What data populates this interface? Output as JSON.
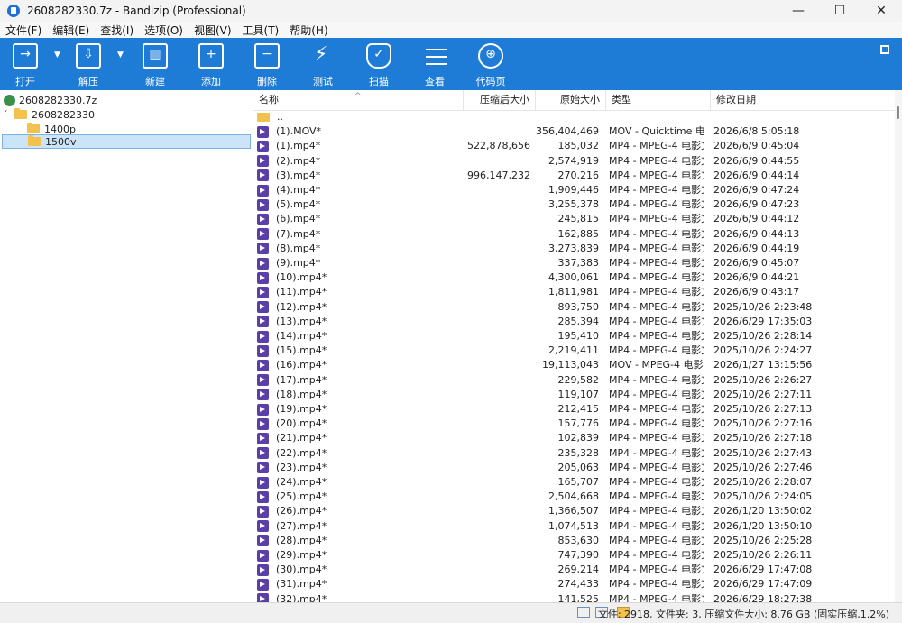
{
  "window": {
    "title": "2608282330.7z - Bandizip (Professional)",
    "minimize": "—",
    "maximize": "☐",
    "close": "✕"
  },
  "menu": [
    "文件(F)",
    "编辑(E)",
    "查找(I)",
    "选项(O)",
    "视图(V)",
    "工具(T)",
    "帮助(H)"
  ],
  "toolbar": {
    "color": "#1e7bd6",
    "buttons": [
      {
        "label": "打开",
        "icon": "open-icon"
      },
      {
        "label": "解压",
        "icon": "extract-icon"
      },
      {
        "label": "新建",
        "icon": "new-archive-icon"
      },
      {
        "label": "添加",
        "icon": "add-icon"
      },
      {
        "label": "删除",
        "icon": "delete-icon"
      },
      {
        "label": "测试",
        "icon": "test-icon"
      },
      {
        "label": "扫描",
        "icon": "scan-shield-icon"
      },
      {
        "label": "查看",
        "icon": "view-list-icon"
      },
      {
        "label": "代码页",
        "icon": "codepage-globe-icon"
      }
    ]
  },
  "tree": {
    "archive": "2608282330.7z",
    "root_folder": "2608282330",
    "children": [
      "1400p",
      "1500v"
    ],
    "selected": "1500v"
  },
  "list": {
    "headers": {
      "name": "名称",
      "compressed": "压缩后大小",
      "original": "原始大小",
      "type": "类型",
      "modified": "修改日期"
    },
    "rows": [
      {
        "name": "..",
        "compressed": "",
        "original": "",
        "type": "",
        "modified": ""
      },
      {
        "name": "(1).MOV*",
        "compressed": "",
        "original": "356,404,469",
        "type": "MOV - Quicktime 电...",
        "modified": "2026/6/8 5:05:18"
      },
      {
        "name": "(1).mp4*",
        "compressed": "522,878,656",
        "original": "185,032",
        "type": "MP4 - MPEG-4 电影文...",
        "modified": "2026/6/9 0:45:04"
      },
      {
        "name": "(2).mp4*",
        "compressed": "",
        "original": "2,574,919",
        "type": "MP4 - MPEG-4 电影文...",
        "modified": "2026/6/9 0:44:55"
      },
      {
        "name": "(3).mp4*",
        "compressed": "996,147,232",
        "original": "270,216",
        "type": "MP4 - MPEG-4 电影文...",
        "modified": "2026/6/9 0:44:14"
      },
      {
        "name": "(4).mp4*",
        "compressed": "",
        "original": "1,909,446",
        "type": "MP4 - MPEG-4 电影文...",
        "modified": "2026/6/9 0:47:24"
      },
      {
        "name": "(5).mp4*",
        "compressed": "",
        "original": "3,255,378",
        "type": "MP4 - MPEG-4 电影文...",
        "modified": "2026/6/9 0:47:23"
      },
      {
        "name": "(6).mp4*",
        "compressed": "",
        "original": "245,815",
        "type": "MP4 - MPEG-4 电影文...",
        "modified": "2026/6/9 0:44:12"
      },
      {
        "name": "(7).mp4*",
        "compressed": "",
        "original": "162,885",
        "type": "MP4 - MPEG-4 电影文...",
        "modified": "2026/6/9 0:44:13"
      },
      {
        "name": "(8).mp4*",
        "compressed": "",
        "original": "3,273,839",
        "type": "MP4 - MPEG-4 电影文...",
        "modified": "2026/6/9 0:44:19"
      },
      {
        "name": "(9).mp4*",
        "compressed": "",
        "original": "337,383",
        "type": "MP4 - MPEG-4 电影文...",
        "modified": "2026/6/9 0:45:07"
      },
      {
        "name": "(10).mp4*",
        "compressed": "",
        "original": "4,300,061",
        "type": "MP4 - MPEG-4 电影文...",
        "modified": "2026/6/9 0:44:21"
      },
      {
        "name": "(11).mp4*",
        "compressed": "",
        "original": "1,811,981",
        "type": "MP4 - MPEG-4 电影文...",
        "modified": "2026/6/9 0:43:17"
      },
      {
        "name": "(12).mp4*",
        "compressed": "",
        "original": "893,750",
        "type": "MP4 - MPEG-4 电影文...",
        "modified": "2025/10/26 2:23:48"
      },
      {
        "name": "(13).mp4*",
        "compressed": "",
        "original": "285,394",
        "type": "MP4 - MPEG-4 电影文...",
        "modified": "2026/6/29 17:35:03"
      },
      {
        "name": "(14).mp4*",
        "compressed": "",
        "original": "195,410",
        "type": "MP4 - MPEG-4 电影文...",
        "modified": "2025/10/26 2:28:14"
      },
      {
        "name": "(15).mp4*",
        "compressed": "",
        "original": "2,219,411",
        "type": "MP4 - MPEG-4 电影文...",
        "modified": "2025/10/26 2:24:27"
      },
      {
        "name": "(16).mp4*",
        "compressed": "",
        "original": "19,113,043",
        "type": "MOV - MPEG-4 电影文...",
        "modified": "2026/1/27 13:15:56"
      },
      {
        "name": "(17).mp4*",
        "compressed": "",
        "original": "229,582",
        "type": "MP4 - MPEG-4 电影文...",
        "modified": "2025/10/26 2:26:27"
      },
      {
        "name": "(18).mp4*",
        "compressed": "",
        "original": "119,107",
        "type": "MP4 - MPEG-4 电影文...",
        "modified": "2025/10/26 2:27:11"
      },
      {
        "name": "(19).mp4*",
        "compressed": "",
        "original": "212,415",
        "type": "MP4 - MPEG-4 电影文...",
        "modified": "2025/10/26 2:27:13"
      },
      {
        "name": "(20).mp4*",
        "compressed": "",
        "original": "157,776",
        "type": "MP4 - MPEG-4 电影文...",
        "modified": "2025/10/26 2:27:16"
      },
      {
        "name": "(21).mp4*",
        "compressed": "",
        "original": "102,839",
        "type": "MP4 - MPEG-4 电影文...",
        "modified": "2025/10/26 2:27:18"
      },
      {
        "name": "(22).mp4*",
        "compressed": "",
        "original": "235,328",
        "type": "MP4 - MPEG-4 电影文...",
        "modified": "2025/10/26 2:27:43"
      },
      {
        "name": "(23).mp4*",
        "compressed": "",
        "original": "205,063",
        "type": "MP4 - MPEG-4 电影文...",
        "modified": "2025/10/26 2:27:46"
      },
      {
        "name": "(24).mp4*",
        "compressed": "",
        "original": "165,707",
        "type": "MP4 - MPEG-4 电影文...",
        "modified": "2025/10/26 2:28:07"
      },
      {
        "name": "(25).mp4*",
        "compressed": "",
        "original": "2,504,668",
        "type": "MP4 - MPEG-4 电影文...",
        "modified": "2025/10/26 2:24:05"
      },
      {
        "name": "(26).mp4*",
        "compressed": "",
        "original": "1,366,507",
        "type": "MP4 - MPEG-4 电影文...",
        "modified": "2026/1/20 13:50:02"
      },
      {
        "name": "(27).mp4*",
        "compressed": "",
        "original": "1,074,513",
        "type": "MP4 - MPEG-4 电影文...",
        "modified": "2026/1/20 13:50:10"
      },
      {
        "name": "(28).mp4*",
        "compressed": "",
        "original": "853,630",
        "type": "MP4 - MPEG-4 电影文...",
        "modified": "2025/10/26 2:25:28"
      },
      {
        "name": "(29).mp4*",
        "compressed": "",
        "original": "747,390",
        "type": "MP4 - MPEG-4 电影文...",
        "modified": "2025/10/26 2:26:11"
      },
      {
        "name": "(30).mp4*",
        "compressed": "",
        "original": "269,214",
        "type": "MP4 - MPEG-4 电影文...",
        "modified": "2026/6/29 17:47:08"
      },
      {
        "name": "(31).mp4*",
        "compressed": "",
        "original": "274,433",
        "type": "MP4 - MPEG-4 电影文...",
        "modified": "2026/6/29 17:47:09"
      },
      {
        "name": "(32).mp4*",
        "compressed": "",
        "original": "141,525",
        "type": "MP4 - MPEG-4 电影文...",
        "modified": "2026/6/29 18:27:38"
      }
    ]
  },
  "status": {
    "text": "文件: 2918, 文件夹: 3, 压缩文件大小: 8.76 GB (固实压缩,1.2%)"
  }
}
